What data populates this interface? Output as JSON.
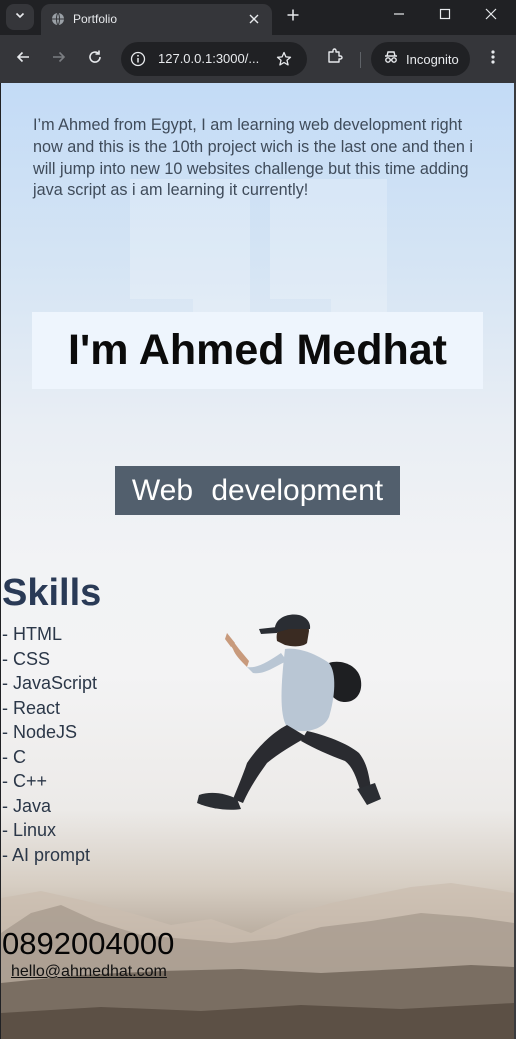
{
  "browser": {
    "tab_title": "Portfolio",
    "url": "127.0.0.1:3000/...",
    "incognito_label": "Incognito"
  },
  "page": {
    "intro": "I’m Ahmed from Egypt, I am learning web development right now and this is the 10th project wich is the last one and then i will jump into new 10 websites challenge but this time adding java script as i am learning it currently!",
    "name": "I'm Ahmed Medhat",
    "role": "Web development",
    "skills_title": "Skills",
    "skills": [
      "- HTML",
      "- CSS",
      "- JavaScript",
      "- React",
      "- NodeJS",
      "- C",
      "- C++",
      "- Java",
      "- Linux",
      "- AI prompt"
    ],
    "phone": "0892004000",
    "email": "hello@ahmedhat.com"
  },
  "colors": {
    "chrome_dark": "#202124",
    "chrome_toolbar": "#35363a",
    "name_box_bg": "#eef5fd",
    "role_box_bg": "#525f6d",
    "skills_title": "#2a3a56"
  }
}
